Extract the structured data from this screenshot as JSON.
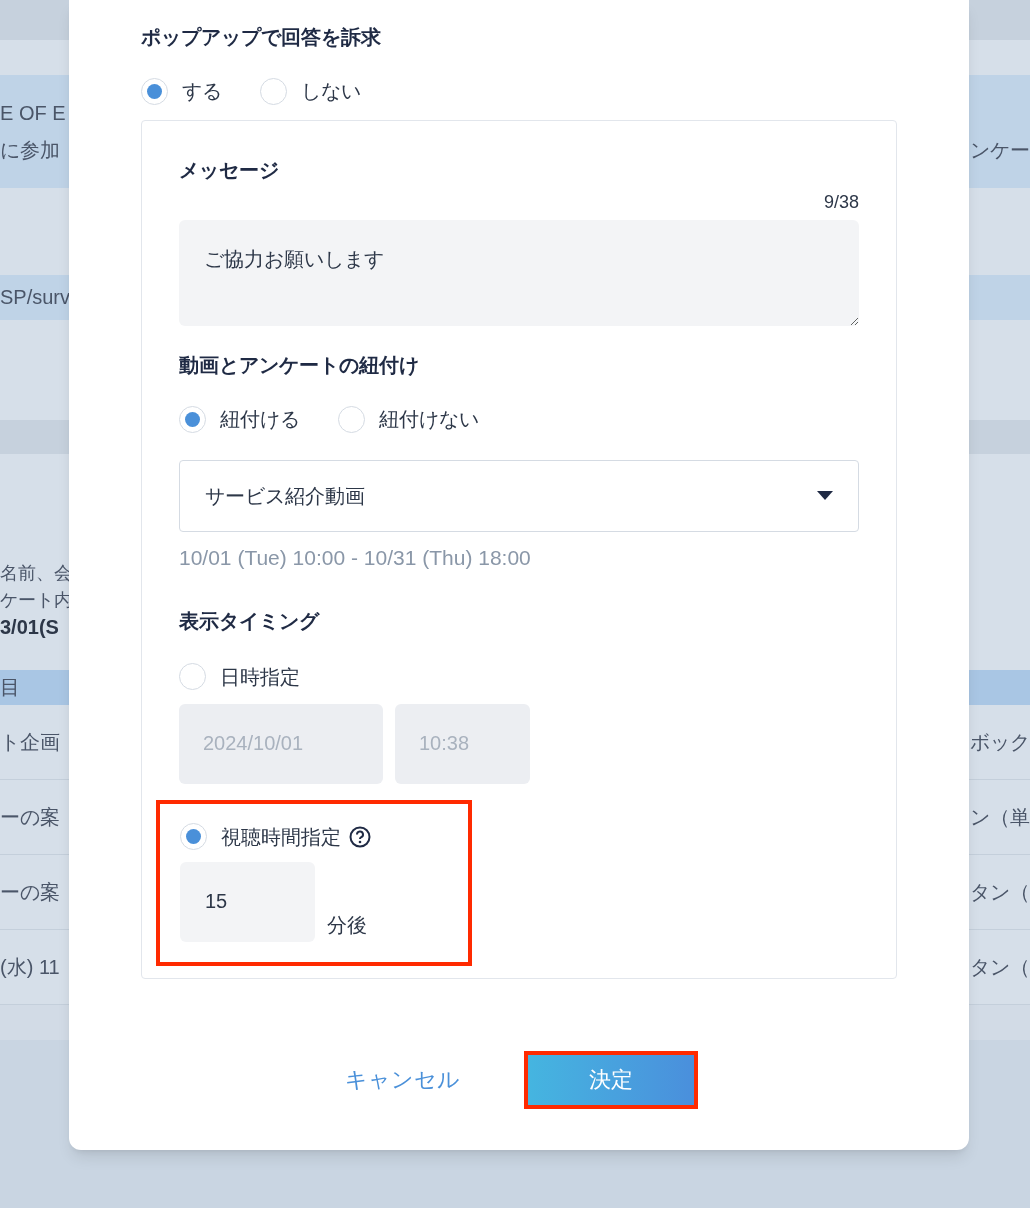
{
  "background": {
    "sections": [
      {
        "kind": "bar"
      },
      {
        "kind": "plain"
      },
      {
        "kind": "band",
        "left": [
          "E OF E",
          "に参加"
        ],
        "right": [
          "ンケー"
        ]
      },
      {
        "kind": "plain"
      },
      {
        "kind": "strip",
        "left": [
          "SP/surv"
        ]
      },
      {
        "kind": "plain"
      },
      {
        "kind": "bar"
      },
      {
        "kind": "info",
        "left": [
          "名前、会",
          "ケート内",
          "3/01(S"
        ]
      },
      {
        "kind": "header",
        "left": [
          "目"
        ]
      },
      {
        "kind": "row",
        "left": [
          "ト企画"
        ],
        "right": [
          "ボック"
        ]
      },
      {
        "kind": "row",
        "left": [
          "ーの案"
        ],
        "right": [
          "ン（単"
        ]
      },
      {
        "kind": "row",
        "left": [
          "ーの案"
        ],
        "right": [
          "タン（"
        ]
      },
      {
        "kind": "row",
        "left": [
          "(水) 11"
        ],
        "right": [
          "タン（"
        ]
      }
    ]
  },
  "modal": {
    "popup": {
      "label": "ポップアップで回答を訴求",
      "options": [
        {
          "label": "する",
          "selected": true
        },
        {
          "label": "しない",
          "selected": false
        }
      ]
    },
    "message": {
      "label": "メッセージ",
      "counter": "9/38",
      "value": "ご協力お願いします"
    },
    "link": {
      "label": "動画とアンケートの紐付け",
      "options": [
        {
          "label": "紐付ける",
          "selected": true
        },
        {
          "label": "紐付けない",
          "selected": false
        }
      ],
      "video": "サービス紹介動画",
      "period": "10/01 (Tue) 10:00 - 10/31 (Thu) 18:00"
    },
    "timing": {
      "label": "表示タイミング",
      "datetime": {
        "label": "日時指定",
        "selected": false,
        "date": "2024/10/01",
        "time": "10:38",
        "disabled": true
      },
      "viewtime": {
        "label": "視聴時間指定",
        "selected": true,
        "minutes": "15",
        "unit": "分後",
        "highlighted": true
      }
    },
    "buttons": [
      {
        "kind": "link",
        "label": "キャンセル",
        "highlighted": false
      },
      {
        "kind": "primary",
        "label": "決定",
        "highlighted": true
      }
    ]
  }
}
